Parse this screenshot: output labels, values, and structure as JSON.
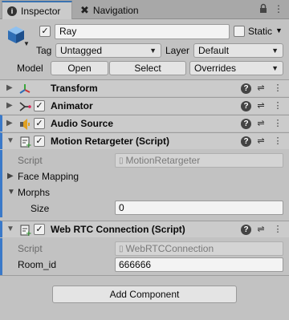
{
  "tabs": [
    {
      "label": "Inspector",
      "icon": "info-icon"
    },
    {
      "label": "Navigation",
      "icon": "navigation-icon"
    }
  ],
  "gameobject": {
    "name": "Ray",
    "active": true,
    "static_label": "Static",
    "static_checked": false,
    "tag_label": "Tag",
    "tag_value": "Untagged",
    "layer_label": "Layer",
    "layer_value": "Default",
    "model_label": "Model",
    "open_label": "Open",
    "select_label": "Select",
    "overrides_label": "Overrides"
  },
  "components": [
    {
      "title": "Transform",
      "icon": "transform-icon",
      "has_checkbox": false
    },
    {
      "title": "Animator",
      "icon": "animator-icon",
      "has_checkbox": true
    },
    {
      "title": "Audio Source",
      "icon": "audio-source-icon",
      "has_checkbox": true
    },
    {
      "title": "Motion Retargeter (Script)",
      "icon": "script-icon",
      "has_checkbox": true
    },
    {
      "title": "Web RTC Connection (Script)",
      "icon": "script-icon",
      "has_checkbox": true
    }
  ],
  "motion_retargeter": {
    "script_label": "Script",
    "script_value": "MotionRetargeter",
    "face_mapping_label": "Face Mapping",
    "morphs_label": "Morphs",
    "size_label": "Size",
    "size_value": "0"
  },
  "web_rtc": {
    "script_label": "Script",
    "script_value": "WebRTCConnection",
    "room_label": "Room_id",
    "room_value": "666666"
  },
  "add_component_label": "Add Component",
  "colors": {
    "accent": "#3a79c9",
    "panel": "#c2c2c2",
    "header": "#cbcbcb"
  }
}
